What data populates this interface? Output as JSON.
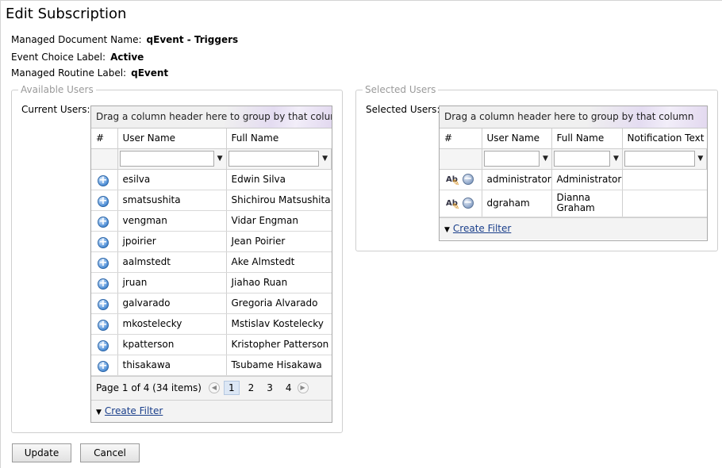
{
  "page": {
    "title": "Edit Subscription"
  },
  "info": {
    "document_label": "Managed Document Name:",
    "document_value": "qEvent - Triggers",
    "event_label": "Event Choice Label:",
    "event_value": "Active",
    "routine_label": "Managed Routine Label:",
    "routine_value": "qEvent"
  },
  "available": {
    "legend": "Available Users",
    "field_label": "Current Users:",
    "group_hint": "Drag a column header here to group by that column",
    "columns": [
      "#",
      "User Name",
      "Full Name"
    ],
    "rows": [
      {
        "user": "esilva",
        "full": "Edwin Silva"
      },
      {
        "user": "smatsushita",
        "full": "Shichirou Matsushita"
      },
      {
        "user": "vengman",
        "full": "Vidar Engman"
      },
      {
        "user": "jpoirier",
        "full": "Jean Poirier"
      },
      {
        "user": "aalmstedt",
        "full": "Ake Almstedt"
      },
      {
        "user": "jruan",
        "full": "Jiahao Ruan"
      },
      {
        "user": "galvarado",
        "full": "Gregoria Alvarado"
      },
      {
        "user": "mkostelecky",
        "full": "Mstislav Kostelecky"
      },
      {
        "user": "kpatterson",
        "full": "Kristopher Patterson"
      },
      {
        "user": "thisakawa",
        "full": "Tsubame Hisakawa"
      }
    ],
    "pager_text": "Page 1 of 4 (34 items)",
    "pages": [
      "1",
      "2",
      "3",
      "4"
    ],
    "current_page": "1",
    "create_filter": "Create Filter"
  },
  "selected": {
    "legend": "Selected Users",
    "field_label": "Selected Users:",
    "group_hint": "Drag a column header here to group by that column",
    "columns": [
      "#",
      "User Name",
      "Full Name",
      "Notification Text"
    ],
    "rows": [
      {
        "user": "administrator",
        "full": "Administrator",
        "note": ""
      },
      {
        "user": "dgraham",
        "full": "Dianna Graham",
        "note": ""
      }
    ],
    "create_filter": "Create Filter"
  },
  "buttons": {
    "update": "Update",
    "cancel": "Cancel"
  },
  "icons": {
    "add": "add-user-icon",
    "remove": "remove-user-icon",
    "edit": "edit-text-icon",
    "filter": "funnel-icon",
    "prev": "prev-page-icon",
    "next": "next-page-icon"
  },
  "colors": {
    "link": "#1a3f8b",
    "current_page_bg": "#dce7f5",
    "plus_icon": "#4f8fd6"
  }
}
